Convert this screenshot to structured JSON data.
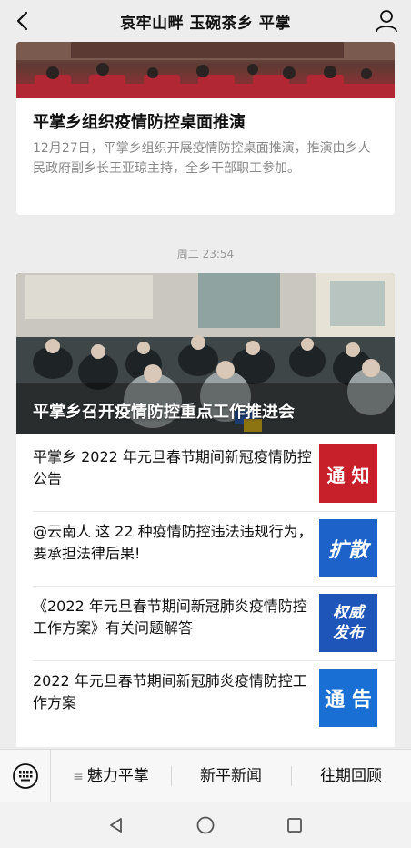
{
  "header": {
    "title": "哀牢山畔 玉碗茶乡 平掌"
  },
  "article1": {
    "title": "平掌乡组织疫情防控桌面推演",
    "summary": "12月27日，平掌乡组织开展疫情防控桌面推演，推演由乡人民政府副乡长王亚琼主持，全乡干部职工参加。"
  },
  "timestamp": "周二 23:54",
  "lead": {
    "title": "平掌乡召开疫情防控重点工作推进会"
  },
  "items": [
    {
      "title": "平掌乡 2022 年元旦春节期间新冠疫情防控公告",
      "thumb_text": "通 知",
      "thumb_color": "#c8202a"
    },
    {
      "title": "@云南人 这 22 种疫情防控违法违规行为，要承担法律后果!",
      "thumb_text": "扩散",
      "thumb_color": "#1d62c9"
    },
    {
      "title": "《2022 年元旦春节期间新冠肺炎疫情防控工作方案》有关问题解答",
      "thumb_text": "权威发布",
      "thumb_color": "#1d55b8"
    },
    {
      "title": "2022 年元旦春节期间新冠肺炎疫情防控工作方案",
      "thumb_text": "通 告",
      "thumb_color": "#1a6fd4"
    }
  ],
  "menu": {
    "item1": "魅力平掌",
    "item2": "新平新闻",
    "item3": "往期回顾"
  }
}
